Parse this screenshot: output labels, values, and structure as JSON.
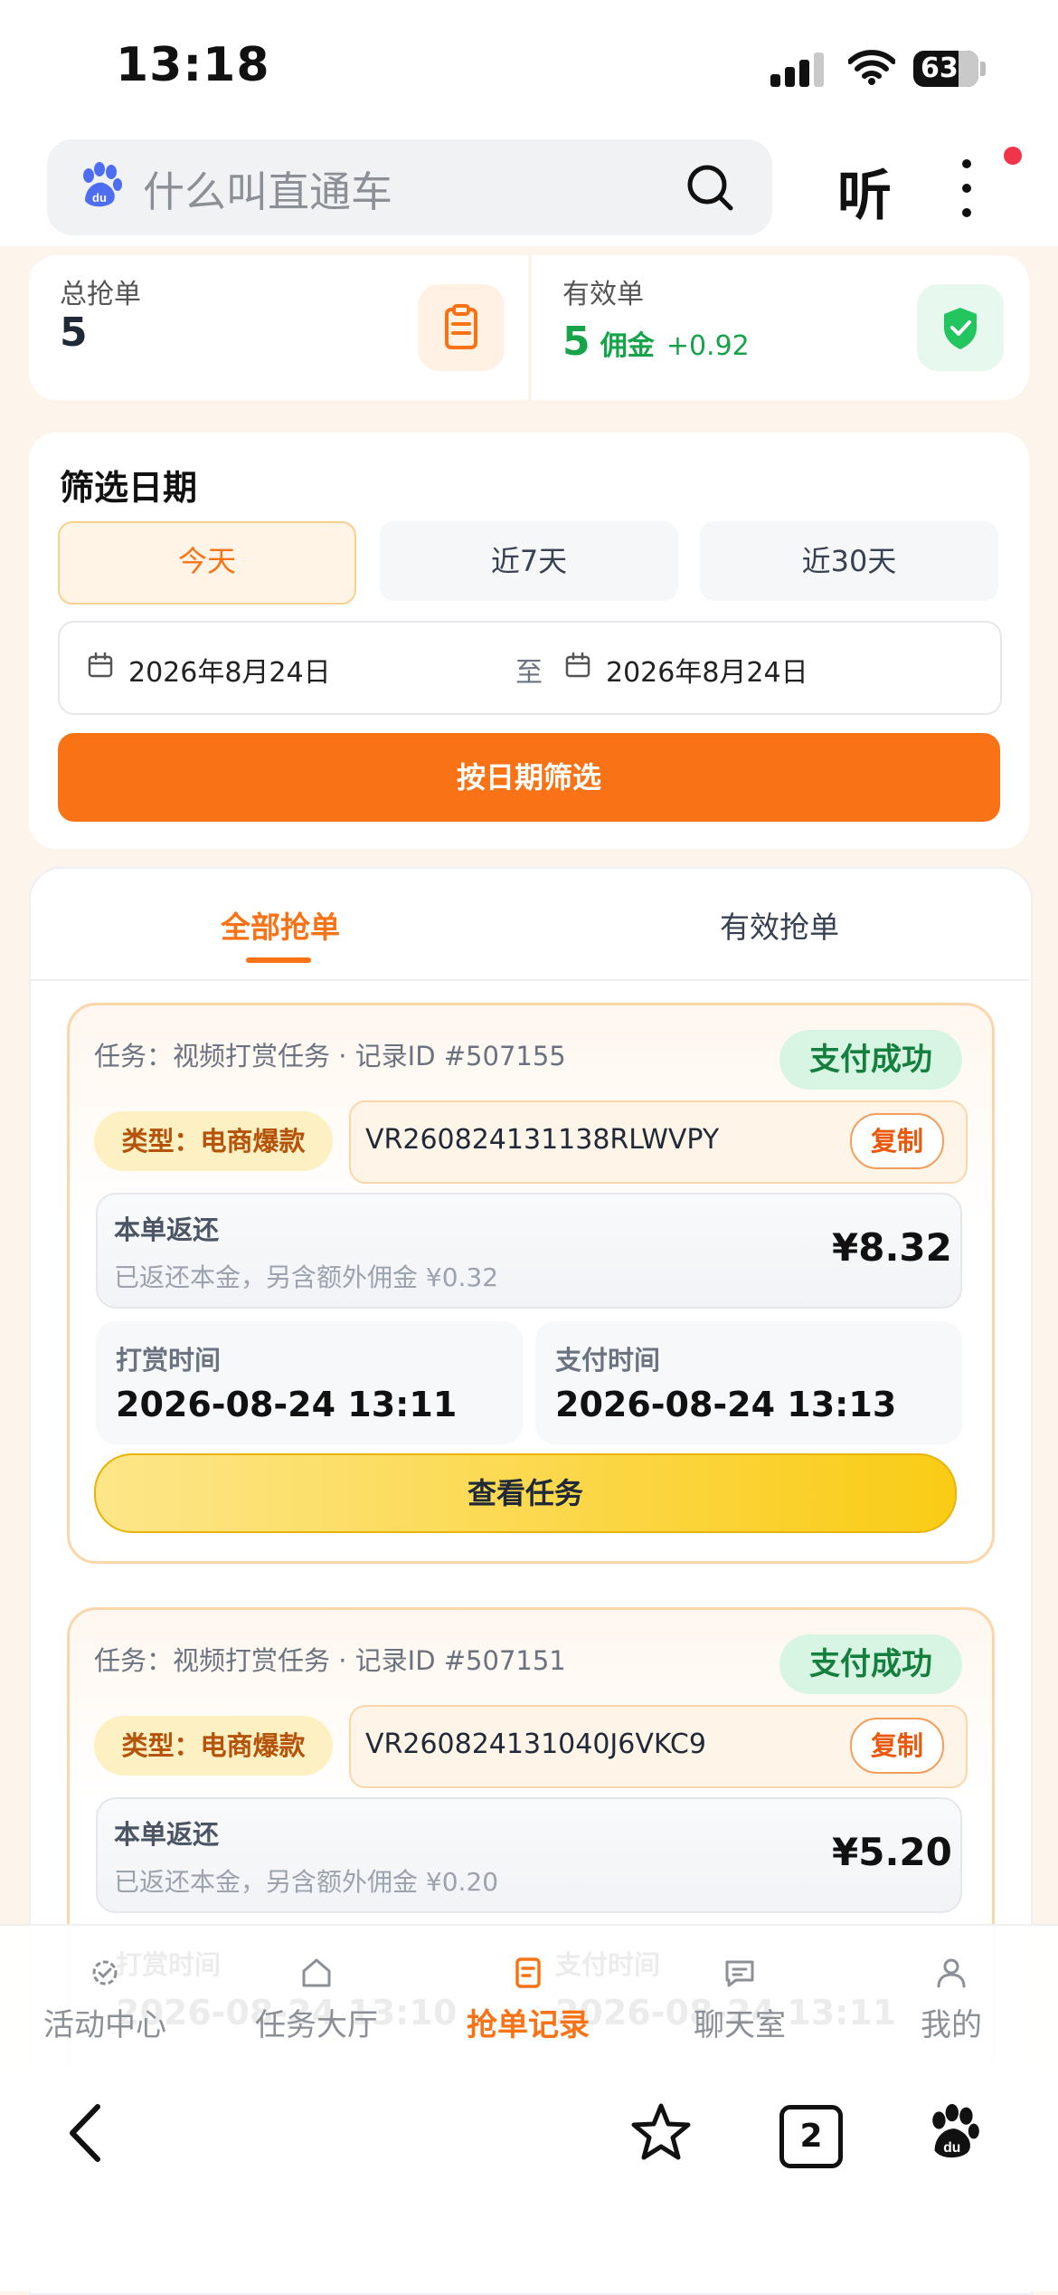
{
  "status_bar": {
    "time": "13:18",
    "battery": "63"
  },
  "browser": {
    "search_placeholder": "什么叫直通车",
    "listen_label": "听"
  },
  "stats": {
    "total_label": "总抢单",
    "total_value": "5",
    "valid_label": "有效单",
    "valid_value": "5",
    "commission_label": "佣金",
    "commission_value": "+0.92"
  },
  "filter": {
    "title": "筛选日期",
    "options": [
      "今天",
      "近7天",
      "近30天"
    ],
    "selected": "今天",
    "start_date": "2026年8月24日",
    "separator": "至",
    "end_date": "2026年8月24日",
    "button_label": "按日期筛选"
  },
  "tabs": {
    "all": "全部抢单",
    "valid": "有效抢单",
    "active": "全部抢单"
  },
  "orders": [
    {
      "title": "任务：视频打赏任务 · 记录ID #507155",
      "status": "支付成功",
      "type": "类型：电商爆款",
      "code": "VR260824131138RLWVPY",
      "copy_label": "复制",
      "refund_label": "本单返还",
      "refund_desc": "已返还本金，另含额外佣金 ¥0.32",
      "amount": "¥8.32",
      "reward_time_label": "打赏时间",
      "reward_time": "2026-08-24 13:11",
      "pay_time_label": "支付时间",
      "pay_time": "2026-08-24 13:13",
      "view_label": "查看任务"
    },
    {
      "title": "任务：视频打赏任务 · 记录ID #507151",
      "status": "支付成功",
      "type": "类型：电商爆款",
      "code": "VR260824131040J6VKC9",
      "copy_label": "复制",
      "refund_label": "本单返还",
      "refund_desc": "已返还本金，另含额外佣金 ¥0.20",
      "amount": "¥5.20",
      "reward_time_label": "打赏时间",
      "reward_time": "2026-08-24 13:10",
      "pay_time_label": "支付时间",
      "pay_time": "2026-08-24 13:11"
    }
  ],
  "nav": {
    "items": [
      {
        "label": "活动中心",
        "icon": "activity-gear-icon"
      },
      {
        "label": "任务大厅",
        "icon": "home-icon"
      },
      {
        "label": "抢单记录",
        "icon": "record-icon"
      },
      {
        "label": "聊天室",
        "icon": "chat-icon"
      },
      {
        "label": "我的",
        "icon": "user-icon"
      }
    ],
    "active": "抢单记录"
  },
  "browser_bottom": {
    "tab_count": "2"
  },
  "colors": {
    "accent": "#f97316",
    "success": "#16a34a",
    "gold": "#facc15"
  }
}
